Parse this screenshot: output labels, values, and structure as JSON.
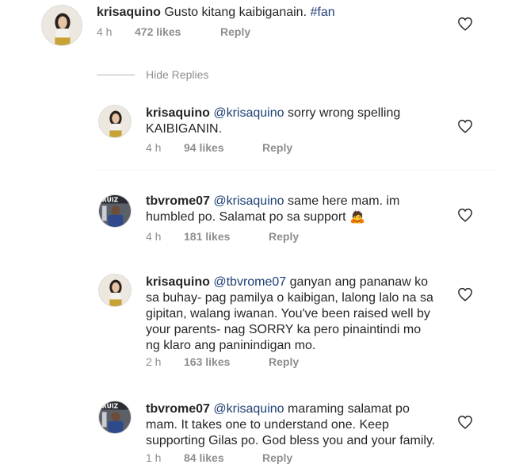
{
  "comments": [
    {
      "username": "krisaquino",
      "pre": "",
      "mention": "",
      "text": " Gusto kitang kaibiganain. ",
      "hashtag": "#fan",
      "time": "4 h",
      "likes": "472 likes",
      "reply": "Reply"
    },
    {
      "username": "krisaquino",
      "mention": "@krisaquino",
      "text": " sorry wrong spelling KAIBIGANIN.",
      "time": "4 h",
      "likes": "94 likes",
      "reply": "Reply"
    },
    {
      "username": "tbvrome07",
      "mention": "@krisaquino",
      "text": "  same here mam. im humbled po. Salamat po sa support ",
      "emoji": "🙇",
      "time": "4 h",
      "likes": "181 likes",
      "reply": "Reply"
    },
    {
      "username": "krisaquino",
      "mention": "@tbvrome07",
      "text": " ganyan ang pananaw ko sa buhay- pag pamilya o kaibigan, lalong lalo na sa gipitan, walang iwanan. You've been raised well by your parents- nag SORRY ka pero pinaintindi mo ng klaro ang paninindigan mo.",
      "time": "2 h",
      "likes": "163 likes",
      "reply": "Reply"
    },
    {
      "username": "tbvrome07",
      "mention": "@krisaquino",
      "text": " maraming salamat po mam. It takes one to understand one. Keep supporting Gilas po. God bless you and your family.",
      "time": "1 h",
      "likes": "84 likes",
      "reply": "Reply"
    }
  ],
  "hide_replies": "Hide Replies",
  "icons": {
    "like": "heart-icon"
  },
  "colors": {
    "mention": "#1f3f73",
    "meta": "#8e8e8e",
    "text": "#262626"
  }
}
